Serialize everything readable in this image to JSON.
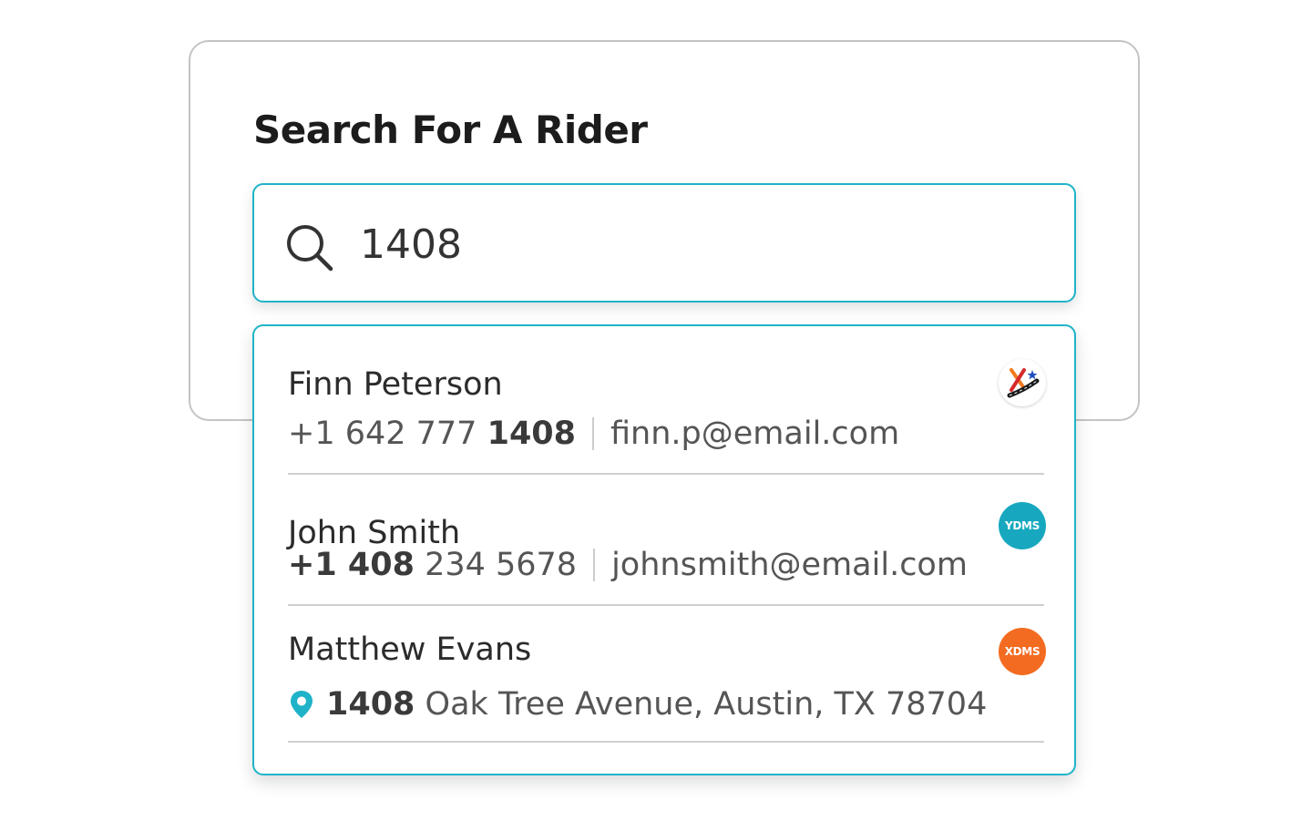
{
  "header": {
    "title": "Search For A Rider"
  },
  "search": {
    "value": "1408"
  },
  "results": [
    {
      "name": "Finn Peterson",
      "phone_pre": "+1 642 777 ",
      "phone_match": "1408",
      "email": "finn.p@email.com",
      "badge": {
        "icon": "x-star-logo-icon"
      }
    },
    {
      "name": "John Smith",
      "phone_match": "+1 408",
      "phone_post": " 234 5678",
      "email": "johnsmith@email.com",
      "badge": {
        "label": "YDMS",
        "color": "#17a8bf"
      }
    },
    {
      "name": "Matthew Evans",
      "address_match": "1408",
      "address_rest": " Oak Tree Avenue, Austin, TX 78704",
      "badge": {
        "label": "XDMS",
        "color": "#f36b21"
      }
    }
  ],
  "colors": {
    "accent": "#1fb3c9",
    "border": "#c4c4c4",
    "text": "#2b2b2b"
  }
}
